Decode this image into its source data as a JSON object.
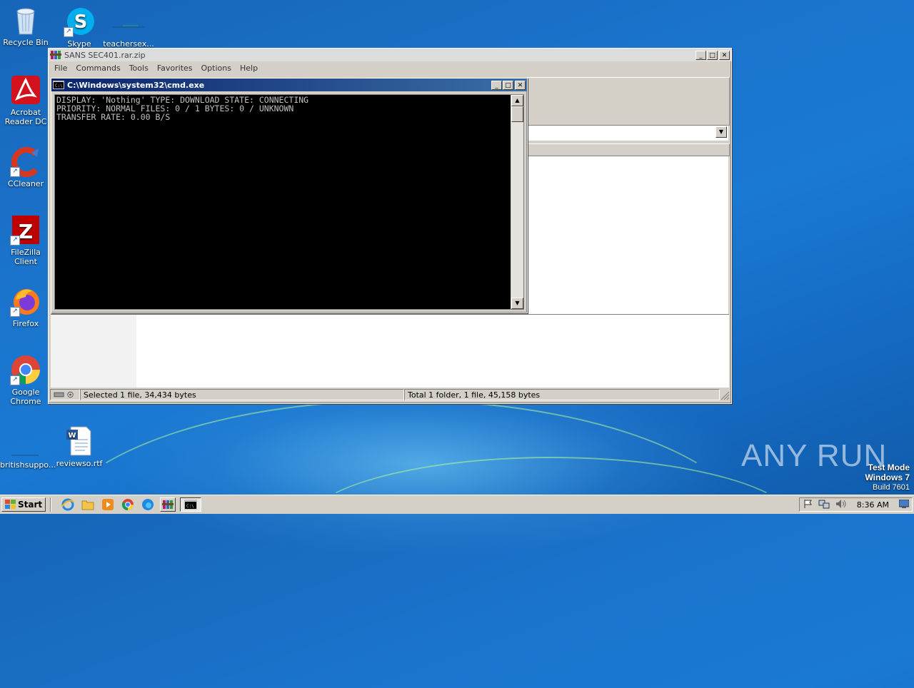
{
  "desktop": {
    "icons": [
      {
        "label": "Recycle Bin"
      },
      {
        "label": "Skype"
      },
      {
        "label": "teachersex..."
      },
      {
        "label": "Acrobat Reader DC"
      },
      {
        "label": "CCleaner"
      },
      {
        "label": "FileZilla Client"
      },
      {
        "label": "Firefox"
      },
      {
        "label": "Google Chrome"
      },
      {
        "label": "britishsuppo..."
      },
      {
        "label": "reviewso.rtf"
      }
    ],
    "watermark": {
      "brand": "ANY RUN",
      "mode_line1": "Test Mode",
      "mode_line2": "Windows 7",
      "mode_line3": "Build 7601"
    }
  },
  "winrar": {
    "title": "SANS SEC401.rar.zip",
    "menu": [
      "File",
      "Commands",
      "Tools",
      "Favorites",
      "Options",
      "Help"
    ],
    "status_left": "Selected 1 file, 34,434 bytes",
    "status_right": "Total 1 folder, 1 file, 45,158 bytes"
  },
  "cmd": {
    "title": "C:\\Windows\\system32\\cmd.exe",
    "line1": "DISPLAY: 'Nothing' TYPE: DOWNLOAD STATE: CONNECTING",
    "line2": "PRIORITY: NORMAL FILES: 0 / 1 BYTES: 0 / UNKNOWN",
    "line3": "TRANSFER RATE: 0.00 B/S"
  },
  "taskbar": {
    "start_label": "Start",
    "pinned": [
      "internet-explorer-icon",
      "explorer-folder-icon",
      "media-player-icon",
      "chrome-icon",
      "edge-icon",
      "winrar-icon",
      "cmd-icon"
    ],
    "clock": "8:36 AM"
  },
  "colors": {
    "desktop_blue": "#1a79d3",
    "cmd_bg": "#000000",
    "cmd_text": "#c0c0c0",
    "active_title": "#0a246a"
  }
}
